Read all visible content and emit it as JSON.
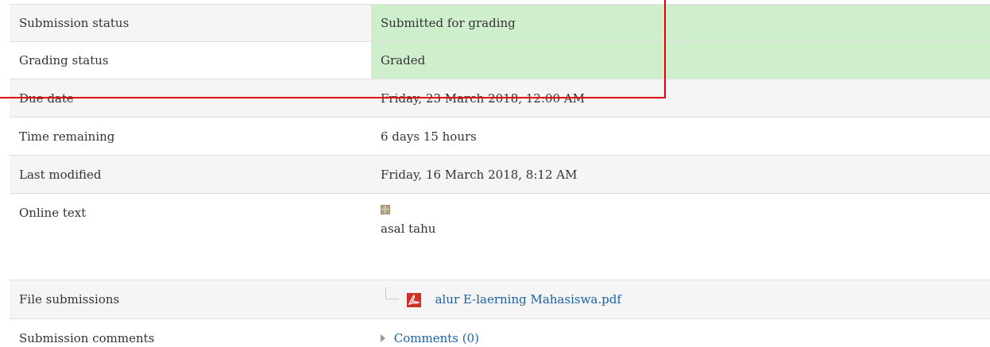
{
  "submission": {
    "rows": [
      {
        "label": "Submission status",
        "value": "Submitted for grading"
      },
      {
        "label": "Grading status",
        "value": "Graded"
      },
      {
        "label": "Due date",
        "value": "Friday, 23 March 2018, 12:00 AM"
      },
      {
        "label": "Time remaining",
        "value": "6 days 15 hours"
      },
      {
        "label": "Last modified",
        "value": "Friday, 16 March 2018, 8:12 AM"
      },
      {
        "label": "Online text",
        "value": "asal tahu"
      },
      {
        "label": "File submissions",
        "value": "alur E-laerning Mahasiswa.pdf"
      },
      {
        "label": "Submission comments",
        "value": "Comments (0)"
      }
    ]
  },
  "colors": {
    "success_bg": "#cfeecb",
    "stripe_bg": "#f5f5f5",
    "link": "#1b5fa8",
    "highlight_box": "#e00000",
    "pdf_icon": "#d0302a"
  },
  "icons": {
    "online_text": "text-document-icon",
    "file": "pdf-file-icon",
    "comments_toggle": "expand-triangle-icon"
  }
}
